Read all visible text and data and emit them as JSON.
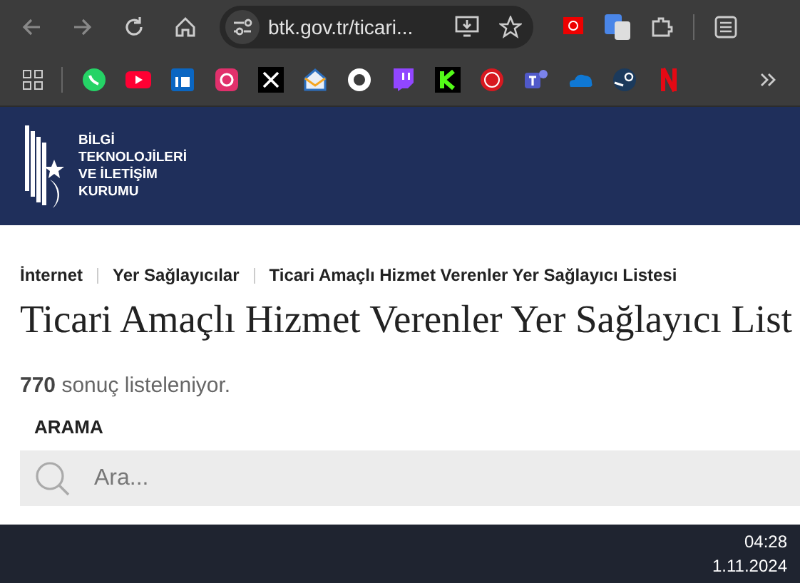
{
  "browser": {
    "address": "btk.gov.tr/ticari..."
  },
  "site_header": {
    "logo_lines": [
      "BİLGİ",
      "TEKNOLOJİLERİ",
      "VE İLETİŞİM",
      "KURUMU"
    ]
  },
  "breadcrumb": [
    "İnternet",
    "Yer Sağlayıcılar",
    "Ticari Amaçlı Hizmet Verenler Yer Sağlayıcı Listesi"
  ],
  "page_title": "Ticari Amaçlı Hizmet Verenler Yer Sağlayıcı List",
  "result_count": "**770** sonuç listeleniyor.",
  "search": {
    "label": "ARAMA",
    "placeholder": "Ara..."
  },
  "taskbar": {
    "time": "04:28",
    "date": "1.11.2024"
  }
}
